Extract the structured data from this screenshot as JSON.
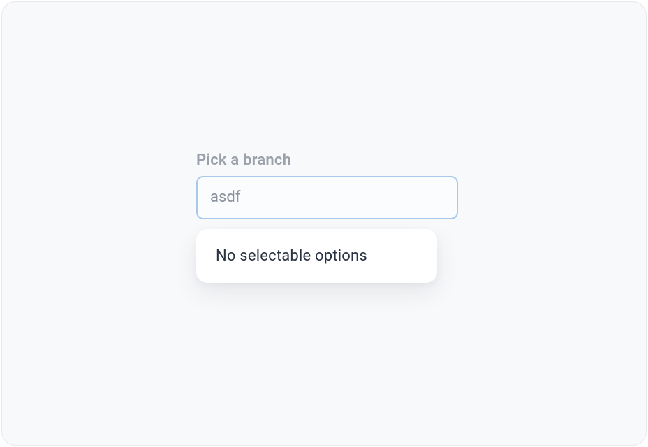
{
  "form": {
    "label": "Pick a branch",
    "input_value": "asdf",
    "input_placeholder": ""
  },
  "dropdown": {
    "empty_message": "No selectable options"
  }
}
